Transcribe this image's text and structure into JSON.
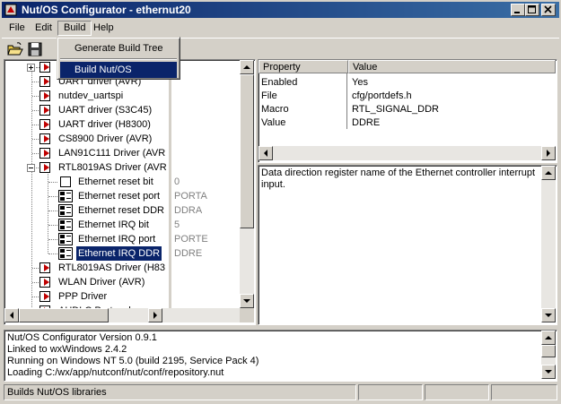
{
  "window": {
    "title": "Nut/OS Configurator - ethernut20"
  },
  "menubar": {
    "items": [
      {
        "label": "File"
      },
      {
        "label": "Edit"
      },
      {
        "label": "Build"
      },
      {
        "label": "Help"
      }
    ]
  },
  "toolbar": {
    "buttons": [
      {
        "icon": "open-folder-icon"
      },
      {
        "icon": "save-disk-icon"
      }
    ]
  },
  "build_menu": {
    "items": [
      {
        "label": "Generate Build Tree"
      },
      {
        "label": "Build Nut/OS"
      }
    ],
    "selected": "Build Nut/OS"
  },
  "tree": {
    "nodes": [
      {
        "label": "UART driver (AVR)",
        "icon": "module-icon",
        "value": ""
      },
      {
        "label": "nutdev_uartspi",
        "icon": "module-icon",
        "value": ""
      },
      {
        "label": "UART driver (S3C45)",
        "icon": "module-icon",
        "value": ""
      },
      {
        "label": "UART driver (H8300)",
        "icon": "module-icon",
        "value": ""
      },
      {
        "label": "CS8900 Driver (AVR)",
        "icon": "module-icon",
        "value": ""
      },
      {
        "label": "LAN91C111 Driver (AVR",
        "icon": "module-icon",
        "value": ""
      },
      {
        "label": "RTL8019AS Driver (AVR",
        "icon": "module-icon",
        "value": ""
      },
      {
        "label": "Ethernet reset bit",
        "icon": "checkbox",
        "value": "0"
      },
      {
        "label": "Ethernet reset port",
        "icon": "option-icon",
        "value": "PORTA"
      },
      {
        "label": "Ethernet reset DDR",
        "icon": "option-icon",
        "value": "DDRA"
      },
      {
        "label": "Ethernet IRQ bit",
        "icon": "option-icon",
        "value": "5"
      },
      {
        "label": "Ethernet IRQ port",
        "icon": "option-icon",
        "value": "PORTE"
      },
      {
        "label": "Ethernet IRQ DDR",
        "icon": "option-icon",
        "value": "DDRE"
      },
      {
        "label": "RTL8019AS Driver (H83",
        "icon": "module-icon",
        "value": ""
      },
      {
        "label": "WLAN Driver (AVR)",
        "icon": "module-icon",
        "value": ""
      },
      {
        "label": "PPP Driver",
        "icon": "module-icon",
        "value": ""
      },
      {
        "label": "AHDLC Protocol",
        "icon": "module-icon",
        "value": ""
      }
    ],
    "selected": "Ethernet IRQ DDR"
  },
  "properties": {
    "headers": [
      "Property",
      "Value"
    ],
    "rows": [
      {
        "property": "Enabled",
        "value": "Yes"
      },
      {
        "property": "File",
        "value": "cfg/portdefs.h"
      },
      {
        "property": "Macro",
        "value": "RTL_SIGNAL_DDR"
      },
      {
        "property": "Value",
        "value": "DDRE"
      }
    ]
  },
  "description": {
    "text": "Data direction register name of the Ethernet controller interrupt input."
  },
  "log": {
    "lines": [
      "Nut/OS Configurator Version 0.9.1",
      "Linked to wxWindows 2.4.2",
      "Running on Windows NT 5.0 (build 2195, Service Pack 4)",
      "Loading C:/wx/app/nutconf/nut/conf/repository.nut"
    ]
  },
  "statusbar": {
    "text": "Builds Nut/OS libraries"
  },
  "colors": {
    "selection": "#0a246a",
    "face": "#d4d0c8",
    "module_arrow": "#c00000"
  }
}
